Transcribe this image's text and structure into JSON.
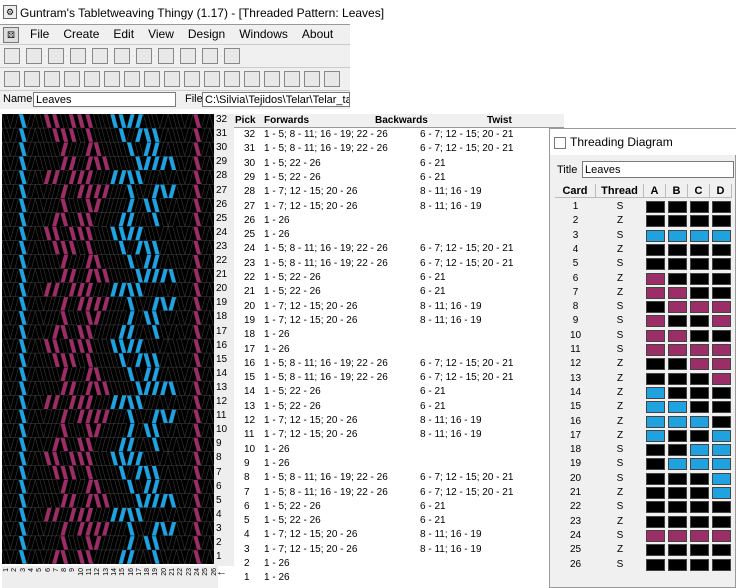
{
  "window": {
    "title": "Guntram's Tabletweaving Thingy (1.17) - [Threaded Pattern: Leaves]"
  },
  "menu": [
    "File",
    "Create",
    "Edit",
    "View",
    "Design",
    "Windows",
    "About"
  ],
  "toolbar1": [
    "open-icon",
    "save-icon",
    "print-icon",
    "dots-icon",
    "move-icon",
    "dice-icon",
    "stripe-icon",
    "grid-icon",
    "copy-icon",
    "book-icon",
    "mail-icon"
  ],
  "toolbar2": [
    "grid-icon",
    "grid-red-icon",
    "sword-icon",
    "number-icon",
    "letter-icon",
    "dice-icon",
    "flag-icon",
    "no-icon",
    "a-icon",
    "swap-icon",
    "flip-icon",
    "circle-icon",
    "grid-icon",
    "grid-icon",
    "dot-icon",
    "dot-icon",
    "dot-icon"
  ],
  "name_label": "Name",
  "name_value": "Leaves",
  "file_label": "File",
  "file_value": "C:\\Silvia\\Tejidos\\Telar\\Telar_tarje",
  "colors": {
    "black": "#000000",
    "pink": "#9b2e67",
    "blue": "#1ea3e0",
    "green": "#00a651"
  },
  "table": {
    "headers": {
      "pick": "Pick",
      "forwards": "Forwards",
      "backwards": "Backwards",
      "twist": "Twist"
    },
    "rows": [
      {
        "pick": "32",
        "fwd": "1 - 5; 8 - 11; 16 - 19; 22 - 26",
        "bwd": "6 - 7; 12 - 15; 20 - 21"
      },
      {
        "pick": "31",
        "fwd": "1 - 5; 8 - 11; 16 - 19; 22 - 26",
        "bwd": "6 - 7; 12 - 15; 20 - 21"
      },
      {
        "pick": "30",
        "fwd": "1 - 5; 22 - 26",
        "bwd": "6 - 21"
      },
      {
        "pick": "29",
        "fwd": "1 - 5; 22 - 26",
        "bwd": "6 - 21"
      },
      {
        "pick": "28",
        "fwd": "1 - 7; 12 - 15; 20 - 26",
        "bwd": "8 - 11; 16 - 19"
      },
      {
        "pick": "27",
        "fwd": "1 - 7; 12 - 15; 20 - 26",
        "bwd": "8 - 11; 16 - 19"
      },
      {
        "pick": "26",
        "fwd": "1 - 26",
        "bwd": ""
      },
      {
        "pick": "25",
        "fwd": "1 - 26",
        "bwd": ""
      },
      {
        "pick": "24",
        "fwd": "1 - 5; 8 - 11; 16 - 19; 22 - 26",
        "bwd": "6 - 7; 12 - 15; 20 - 21"
      },
      {
        "pick": "23",
        "fwd": "1 - 5; 8 - 11; 16 - 19; 22 - 26",
        "bwd": "6 - 7; 12 - 15; 20 - 21"
      },
      {
        "pick": "22",
        "fwd": "1 - 5; 22 - 26",
        "bwd": "6 - 21"
      },
      {
        "pick": "21",
        "fwd": "1 - 5; 22 - 26",
        "bwd": "6 - 21"
      },
      {
        "pick": "20",
        "fwd": "1 - 7; 12 - 15; 20 - 26",
        "bwd": "8 - 11; 16 - 19"
      },
      {
        "pick": "19",
        "fwd": "1 - 7; 12 - 15; 20 - 26",
        "bwd": "8 - 11; 16 - 19"
      },
      {
        "pick": "18",
        "fwd": "1 - 26",
        "bwd": ""
      },
      {
        "pick": "17",
        "fwd": "1 - 26",
        "bwd": ""
      },
      {
        "pick": "16",
        "fwd": "1 - 5; 8 - 11; 16 - 19; 22 - 26",
        "bwd": "6 - 7; 12 - 15; 20 - 21"
      },
      {
        "pick": "15",
        "fwd": "1 - 5; 8 - 11; 16 - 19; 22 - 26",
        "bwd": "6 - 7; 12 - 15; 20 - 21"
      },
      {
        "pick": "14",
        "fwd": "1 - 5; 22 - 26",
        "bwd": "6 - 21"
      },
      {
        "pick": "13",
        "fwd": "1 - 5; 22 - 26",
        "bwd": "6 - 21"
      },
      {
        "pick": "12",
        "fwd": "1 - 7; 12 - 15; 20 - 26",
        "bwd": "8 - 11; 16 - 19"
      },
      {
        "pick": "11",
        "fwd": "1 - 7; 12 - 15; 20 - 26",
        "bwd": "8 - 11; 16 - 19"
      },
      {
        "pick": "10",
        "fwd": "1 - 26",
        "bwd": ""
      },
      {
        "pick": "9",
        "fwd": "1 - 26",
        "bwd": ""
      },
      {
        "pick": "8",
        "fwd": "1 - 5; 8 - 11; 16 - 19; 22 - 26",
        "bwd": "6 - 7; 12 - 15; 20 - 21"
      },
      {
        "pick": "7",
        "fwd": "1 - 5; 8 - 11; 16 - 19; 22 - 26",
        "bwd": "6 - 7; 12 - 15; 20 - 21"
      },
      {
        "pick": "6",
        "fwd": "1 - 5; 22 - 26",
        "bwd": "6 - 21"
      },
      {
        "pick": "5",
        "fwd": "1 - 5; 22 - 26",
        "bwd": "6 - 21"
      },
      {
        "pick": "4",
        "fwd": "1 - 7; 12 - 15; 20 - 26",
        "bwd": "8 - 11; 16 - 19"
      },
      {
        "pick": "3",
        "fwd": "1 - 7; 12 - 15; 20 - 26",
        "bwd": "8 - 11; 16 - 19"
      },
      {
        "pick": "2",
        "fwd": "1 - 26",
        "bwd": ""
      },
      {
        "pick": "1",
        "fwd": "1 - 26",
        "bwd": ""
      }
    ]
  },
  "threading": {
    "title": "Threading Diagram",
    "title_label": "Title",
    "title_value": "Leaves",
    "headers": {
      "card": "Card",
      "thread": "Thread",
      "a": "A",
      "b": "B",
      "c": "C",
      "d": "D"
    },
    "rows": [
      {
        "card": "1",
        "thread": "S",
        "holes": [
          "k",
          "k",
          "k",
          "k"
        ]
      },
      {
        "card": "2",
        "thread": "Z",
        "holes": [
          "k",
          "k",
          "k",
          "k"
        ]
      },
      {
        "card": "3",
        "thread": "S",
        "holes": [
          "b",
          "b",
          "b",
          "b"
        ]
      },
      {
        "card": "4",
        "thread": "Z",
        "holes": [
          "k",
          "k",
          "k",
          "k"
        ]
      },
      {
        "card": "5",
        "thread": "S",
        "holes": [
          "k",
          "k",
          "k",
          "k"
        ]
      },
      {
        "card": "6",
        "thread": "Z",
        "holes": [
          "p",
          "k",
          "k",
          "k"
        ]
      },
      {
        "card": "7",
        "thread": "Z",
        "holes": [
          "p",
          "p",
          "k",
          "k"
        ]
      },
      {
        "card": "8",
        "thread": "S",
        "holes": [
          "k",
          "p",
          "p",
          "p"
        ]
      },
      {
        "card": "9",
        "thread": "S",
        "holes": [
          "p",
          "k",
          "k",
          "p"
        ]
      },
      {
        "card": "10",
        "thread": "S",
        "holes": [
          "p",
          "p",
          "k",
          "k"
        ]
      },
      {
        "card": "11",
        "thread": "S",
        "holes": [
          "p",
          "p",
          "p",
          "p"
        ]
      },
      {
        "card": "12",
        "thread": "Z",
        "holes": [
          "k",
          "k",
          "p",
          "p"
        ]
      },
      {
        "card": "13",
        "thread": "Z",
        "holes": [
          "k",
          "k",
          "k",
          "p"
        ]
      },
      {
        "card": "14",
        "thread": "Z",
        "holes": [
          "b",
          "k",
          "k",
          "k"
        ]
      },
      {
        "card": "15",
        "thread": "Z",
        "holes": [
          "b",
          "b",
          "k",
          "k"
        ]
      },
      {
        "card": "16",
        "thread": "Z",
        "holes": [
          "b",
          "b",
          "b",
          "k"
        ]
      },
      {
        "card": "17",
        "thread": "Z",
        "holes": [
          "b",
          "k",
          "k",
          "b"
        ]
      },
      {
        "card": "18",
        "thread": "S",
        "holes": [
          "k",
          "k",
          "b",
          "b"
        ]
      },
      {
        "card": "19",
        "thread": "S",
        "holes": [
          "k",
          "b",
          "b",
          "b"
        ]
      },
      {
        "card": "20",
        "thread": "S",
        "holes": [
          "k",
          "k",
          "k",
          "b"
        ]
      },
      {
        "card": "21",
        "thread": "Z",
        "holes": [
          "k",
          "k",
          "k",
          "b"
        ]
      },
      {
        "card": "22",
        "thread": "S",
        "holes": [
          "k",
          "k",
          "k",
          "k"
        ]
      },
      {
        "card": "23",
        "thread": "Z",
        "holes": [
          "k",
          "k",
          "k",
          "k"
        ]
      },
      {
        "card": "24",
        "thread": "S",
        "holes": [
          "p",
          "p",
          "p",
          "p"
        ]
      },
      {
        "card": "25",
        "thread": "Z",
        "holes": [
          "k",
          "k",
          "k",
          "k"
        ]
      },
      {
        "card": "26",
        "thread": "S",
        "holes": [
          "k",
          "k",
          "k",
          "k"
        ]
      }
    ]
  }
}
